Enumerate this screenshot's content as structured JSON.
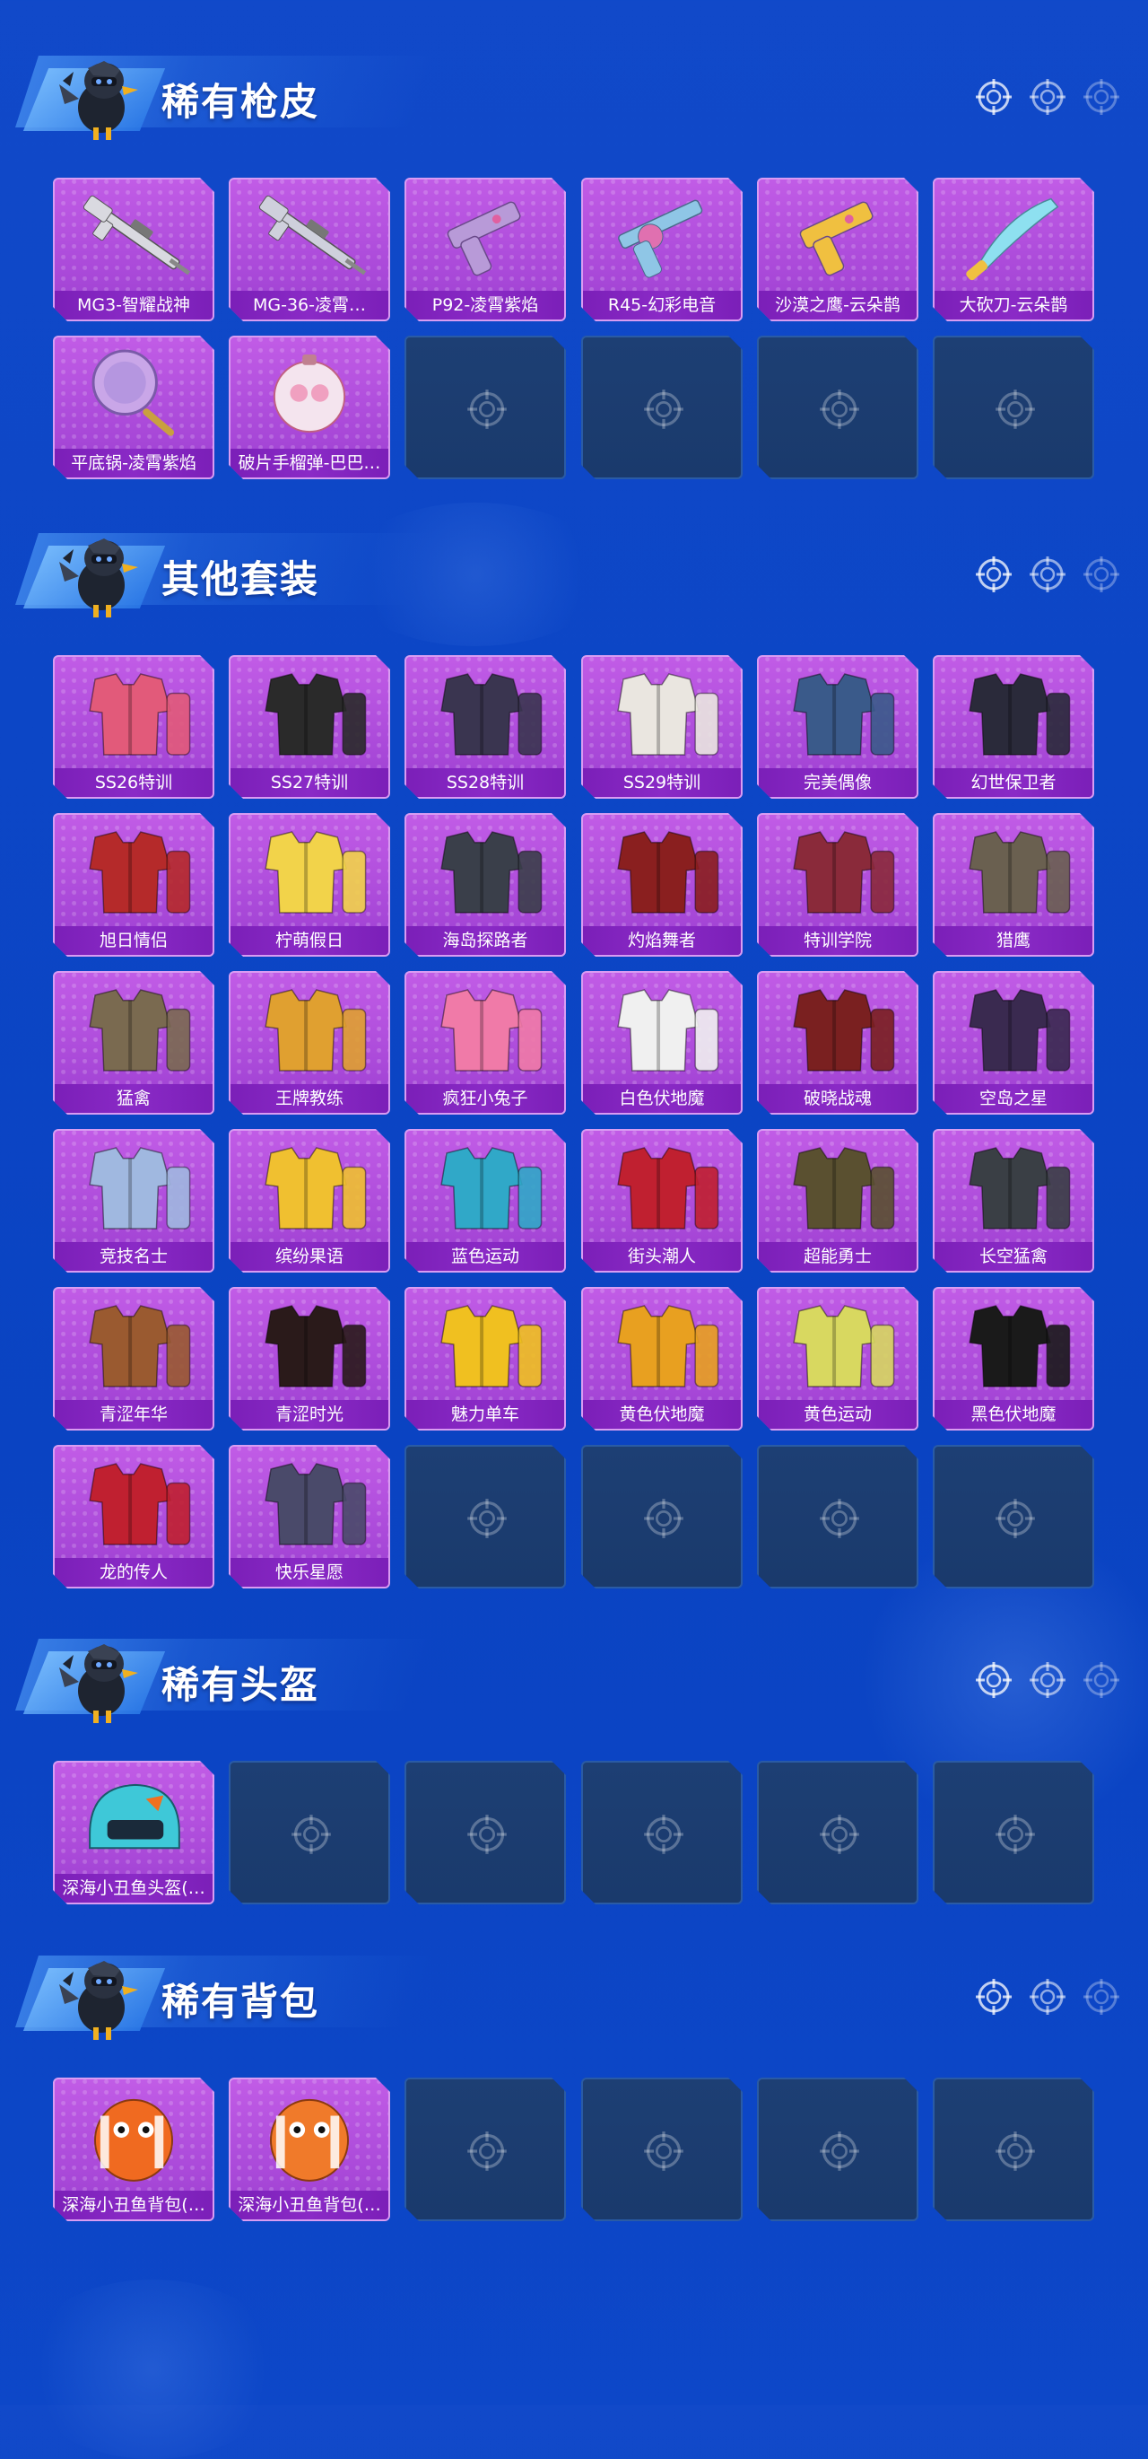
{
  "sections": [
    {
      "title": "稀有枪皮",
      "items": [
        {
          "label": "MG3-智耀战神",
          "icon": "machine-gun-icon",
          "color": "#d9d9e0"
        },
        {
          "label": "MG-36-凌霄…",
          "icon": "rifle-icon",
          "color": "#cfd0dc"
        },
        {
          "label": "P92-凌霄紫焰",
          "icon": "pistol-icon",
          "color": "#b89ad8"
        },
        {
          "label": "R45-幻彩电音",
          "icon": "revolver-icon",
          "color": "#8fc6e6"
        },
        {
          "label": "沙漠之鹰-云朵鹊",
          "icon": "pistol-icon",
          "color": "#f0c040"
        },
        {
          "label": "大砍刀-云朵鹊",
          "icon": "machete-icon",
          "color": "#8ee0f0"
        },
        {
          "label": "平底锅-凌霄紫焰",
          "icon": "pan-icon",
          "color": "#c9a6e8"
        },
        {
          "label": "破片手榴弹-巴巴…",
          "icon": "grenade-icon",
          "color": "#f4e4ee"
        }
      ],
      "empty_slots": 4
    },
    {
      "title": "其他套装",
      "items": [
        {
          "label": "SS26特训",
          "icon": "outfit-icon",
          "color": "#e25a7a"
        },
        {
          "label": "SS27特训",
          "icon": "outfit-icon",
          "color": "#2a2a2a"
        },
        {
          "label": "SS28特训",
          "icon": "outfit-icon",
          "color": "#3a3550"
        },
        {
          "label": "SS29特训",
          "icon": "outfit-icon",
          "color": "#eae6e0"
        },
        {
          "label": "完美偶像",
          "icon": "outfit-icon",
          "color": "#3a5a8a"
        },
        {
          "label": "幻世保卫者",
          "icon": "outfit-icon",
          "color": "#2a2a3a"
        },
        {
          "label": "旭日情侣",
          "icon": "outfit-icon",
          "color": "#b52a2a"
        },
        {
          "label": "柠萌假日",
          "icon": "outfit-icon",
          "color": "#f2d34a"
        },
        {
          "label": "海岛探路者",
          "icon": "outfit-icon",
          "color": "#3a3f4a"
        },
        {
          "label": "灼焰舞者",
          "icon": "outfit-icon",
          "color": "#8a1f1f"
        },
        {
          "label": "特训学院",
          "icon": "outfit-icon",
          "color": "#8a2a3a"
        },
        {
          "label": "猎鹰",
          "icon": "outfit-icon",
          "color": "#6a6050"
        },
        {
          "label": "猛禽",
          "icon": "outfit-icon",
          "color": "#7a6a50"
        },
        {
          "label": "王牌教练",
          "icon": "outfit-icon",
          "color": "#e0a030"
        },
        {
          "label": "疯狂小兔子",
          "icon": "outfit-icon",
          "color": "#f07aa8"
        },
        {
          "label": "白色伏地魔",
          "icon": "outfit-icon",
          "color": "#f0f0f0"
        },
        {
          "label": "破晓战魂",
          "icon": "outfit-icon",
          "color": "#7a2020"
        },
        {
          "label": "空岛之星",
          "icon": "outfit-icon",
          "color": "#3a2a50"
        },
        {
          "label": "竞技名士",
          "icon": "outfit-icon",
          "color": "#a0b8e0"
        },
        {
          "label": "缤纷果语",
          "icon": "outfit-icon",
          "color": "#f0c030"
        },
        {
          "label": "蓝色运动",
          "icon": "outfit-icon",
          "color": "#30a8c8"
        },
        {
          "label": "街头潮人",
          "icon": "outfit-icon",
          "color": "#c02030"
        },
        {
          "label": "超能勇士",
          "icon": "outfit-icon",
          "color": "#5a5030"
        },
        {
          "label": "长空猛禽",
          "icon": "outfit-icon",
          "color": "#3a3f45"
        },
        {
          "label": "青涩年华",
          "icon": "outfit-icon",
          "color": "#9a5a30"
        },
        {
          "label": "青涩时光",
          "icon": "outfit-icon",
          "color": "#2a1a1a"
        },
        {
          "label": "魅力单车",
          "icon": "outfit-icon",
          "color": "#f0c020"
        },
        {
          "label": "黄色伏地魔",
          "icon": "outfit-icon",
          "color": "#e8a020"
        },
        {
          "label": "黄色运动",
          "icon": "outfit-icon",
          "color": "#d8d860"
        },
        {
          "label": "黑色伏地魔",
          "icon": "outfit-icon",
          "color": "#1a1a1a"
        },
        {
          "label": "龙的传人",
          "icon": "outfit-icon",
          "color": "#c02030"
        },
        {
          "label": "快乐星愿",
          "icon": "outfit-icon",
          "color": "#4a4a6a"
        }
      ],
      "empty_slots": 4
    },
    {
      "title": "稀有头盔",
      "items": [
        {
          "label": "深海小丑鱼头盔(…",
          "icon": "helmet-icon",
          "color": "#3ec8d8"
        }
      ],
      "empty_slots": 5
    },
    {
      "title": "稀有背包",
      "items": [
        {
          "label": "深海小丑鱼背包(…",
          "icon": "backpack-icon",
          "color": "#f06a20"
        },
        {
          "label": "深海小丑鱼背包(…",
          "icon": "backpack-icon",
          "color": "#f07a2a"
        }
      ],
      "empty_slots": 4
    }
  ],
  "colors": {
    "background": "#0c46c6",
    "card_fill": "#b352de",
    "label_bar": "#7b1fb8",
    "empty_card": "#1c3d70"
  }
}
